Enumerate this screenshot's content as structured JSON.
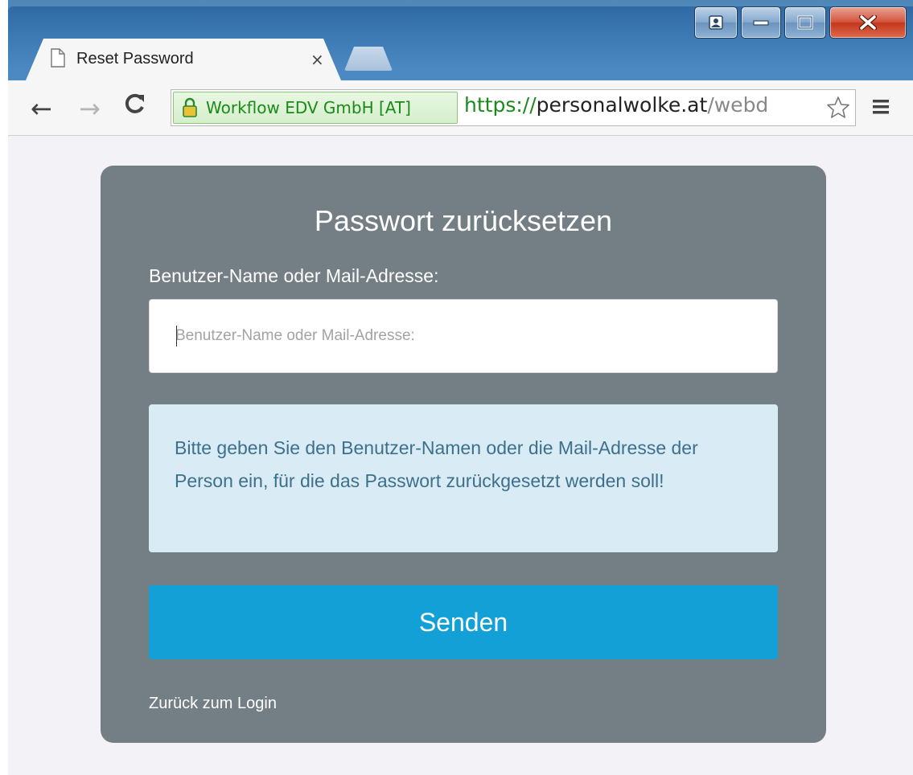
{
  "window": {
    "colors": {
      "frame": "#4b88c1",
      "close": "#c3381d"
    }
  },
  "tabs": [
    {
      "title": "Reset Password",
      "close_label": "×",
      "icon": "page-icon"
    }
  ],
  "toolbar": {
    "back_icon": "←",
    "forward_icon": "→",
    "reload_icon": "C",
    "ev_label": "Workflow EDV GmbH [AT]",
    "url_scheme": "https://",
    "url_host": "personalwolke.at",
    "url_path": "/webd",
    "icons": [
      "lock-icon",
      "star-icon",
      "menu-icon"
    ]
  },
  "form": {
    "title": "Passwort zurücksetzen",
    "field_label": "Benutzer-Name oder Mail-Adresse:",
    "input_value": "",
    "input_placeholder": "Benutzer-Name oder Mail-Adresse:",
    "info_text": "Bitte geben Sie den Benutzer-Namen oder die Mail-Adresse der Person ein, für die das Passwort zurückgesetzt werden soll!",
    "submit_label": "Senden",
    "back_link": "Zurück zum Login",
    "colors": {
      "card": "#737f85",
      "info_bg": "#d9ecf5",
      "info_text": "#3e6f8c",
      "button": "#12a0d6"
    }
  }
}
